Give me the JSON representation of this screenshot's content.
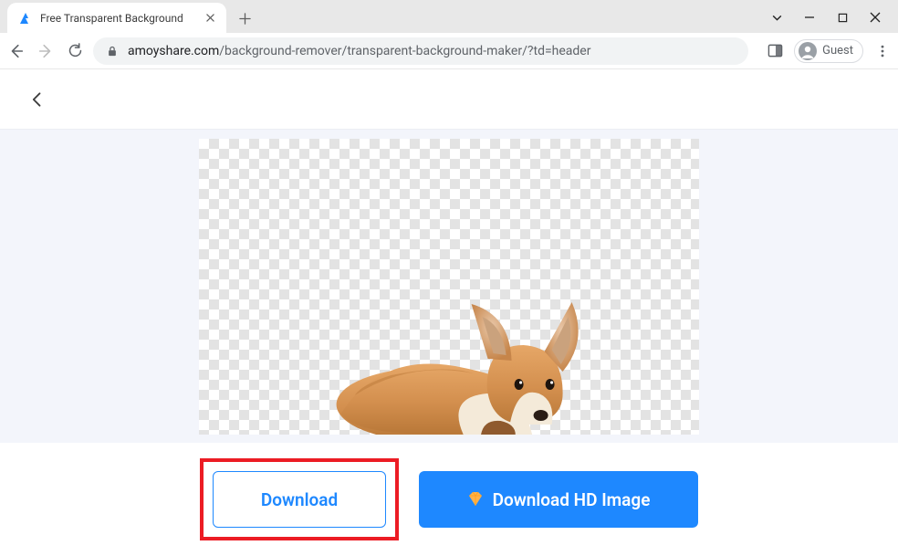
{
  "browser": {
    "tab_title": "Free Transparent Background",
    "url_display_host": "amoyshare.com",
    "url_display_path": "/background-remover/transparent-background-maker/?td=header",
    "guest_label": "Guest"
  },
  "page": {
    "subject_alt": "Dog with transparent background",
    "buttons": {
      "download": "Download",
      "download_hd": "Download HD Image"
    }
  },
  "colors": {
    "accent": "#1e88ff",
    "highlight": "#ec1c24",
    "page_bg": "#f3f5fb"
  }
}
